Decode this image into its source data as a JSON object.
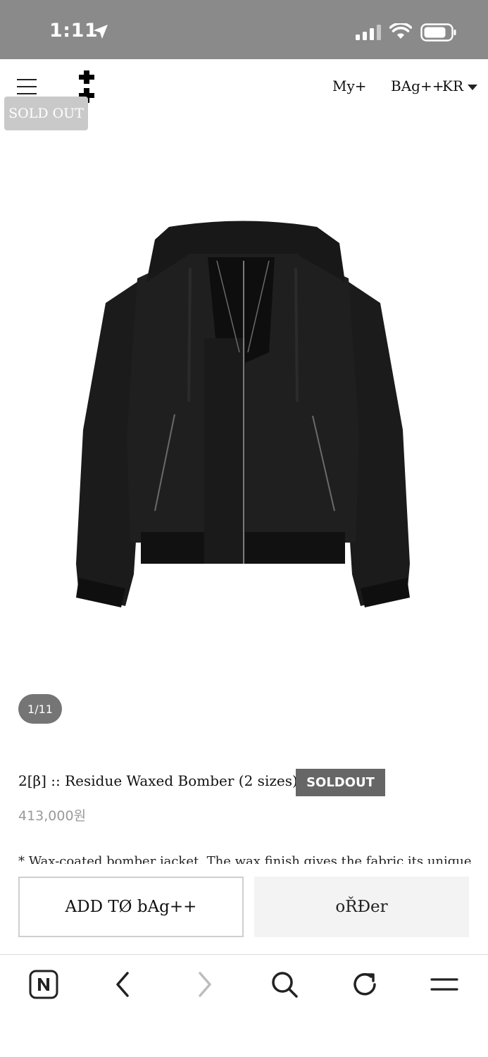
{
  "status_bar": {
    "time": "1:11",
    "icons": [
      "location-arrow-icon",
      "signal-icon",
      "wifi-icon",
      "battery-icon"
    ]
  },
  "header": {
    "menu_icon": "hamburger-menu-icon",
    "logo_icon": "double-cross-logo-icon",
    "nav": {
      "my": "My+",
      "bag": "BAg++",
      "lang": "KR"
    },
    "lang_caret_icon": "caret-down-icon"
  },
  "badge": {
    "sold_out": "SOLD OUT"
  },
  "gallery": {
    "counter": "1/11"
  },
  "product": {
    "title": "2[β] :: Residue Waxed Bomber (2 sizes)",
    "soldout_tag": "SOLDOUT",
    "price": "413,000원",
    "description": "* Wax-coated bomber jacket. The wax finish gives the fabric its unique"
  },
  "actions": {
    "add_to_bag": "ADD TØ bAg++",
    "order": "oŘĐer"
  },
  "browser_toolbar": {
    "icons": [
      "naver-n-icon",
      "back-arrow-icon",
      "forward-arrow-icon",
      "search-icon",
      "refresh-icon",
      "menu-icon"
    ]
  },
  "colors": {
    "status_bar_bg": "#8a8a8a",
    "soldout_badge_bg": "#c9c9c9",
    "soldout_tag_bg": "#666666",
    "counter_bg": "#757575",
    "price_text": "#9a9a9a",
    "order_bg": "#f3f3f3"
  }
}
